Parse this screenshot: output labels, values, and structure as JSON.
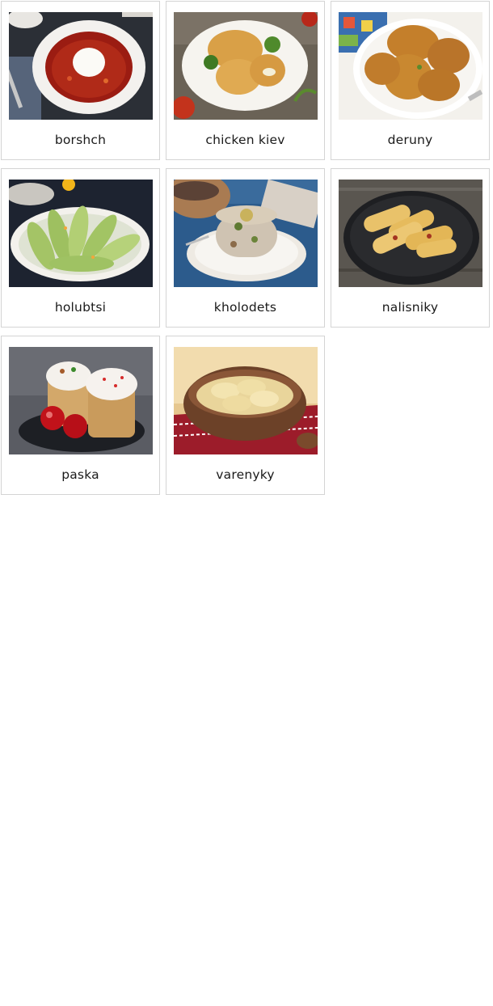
{
  "cards": [
    {
      "label": "borshch",
      "image": "borshch-photo"
    },
    {
      "label": "chicken kiev",
      "image": "chicken-kiev-photo"
    },
    {
      "label": "deruny",
      "image": "deruny-photo"
    },
    {
      "label": "holubtsi",
      "image": "holubtsi-photo"
    },
    {
      "label": "kholodets",
      "image": "kholodets-photo"
    },
    {
      "label": "nalisniky",
      "image": "nalisniky-photo"
    },
    {
      "label": "paska",
      "image": "paska-photo"
    },
    {
      "label": "varenyky",
      "image": "varenyky-photo"
    }
  ]
}
